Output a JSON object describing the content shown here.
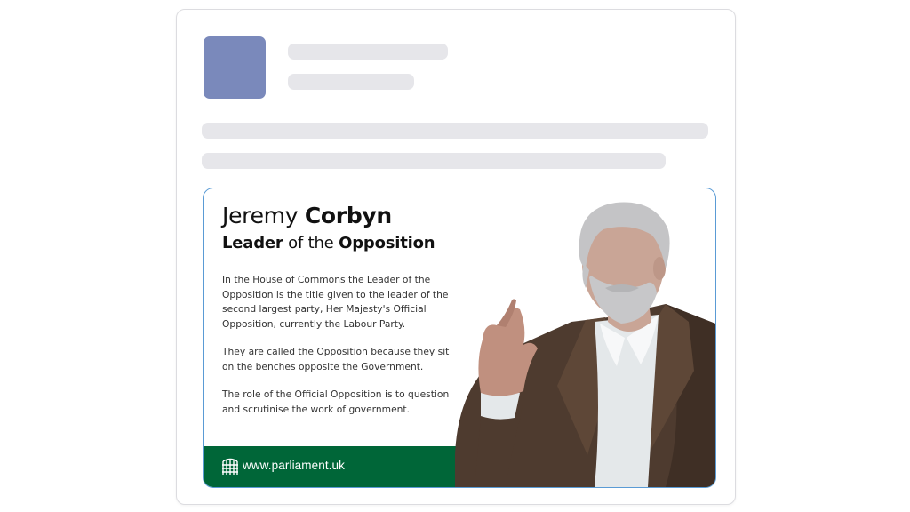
{
  "info_card": {
    "name_first": "Jeremy",
    "name_last": "Corbyn",
    "role_part1": "Leader",
    "role_part2": "of the",
    "role_part3": "Opposition",
    "paragraphs": [
      "In the House of Commons the Leader of the Opposition is the title given to the leader of the second largest party, Her Majesty's Official Opposition, currently the Labour Party.",
      "They are called the Opposition because they sit on the benches opposite the Government.",
      "The role of the Official Opposition is to question and scrutinise the work of government."
    ],
    "footer_url": "www.parliament.uk"
  },
  "colors": {
    "avatar_placeholder": "#7a89bb",
    "skeleton": "#e6e6ea",
    "card_border": "#5a9bd5",
    "footer_green": "#006638"
  },
  "icons": [
    "portcullis-icon"
  ]
}
